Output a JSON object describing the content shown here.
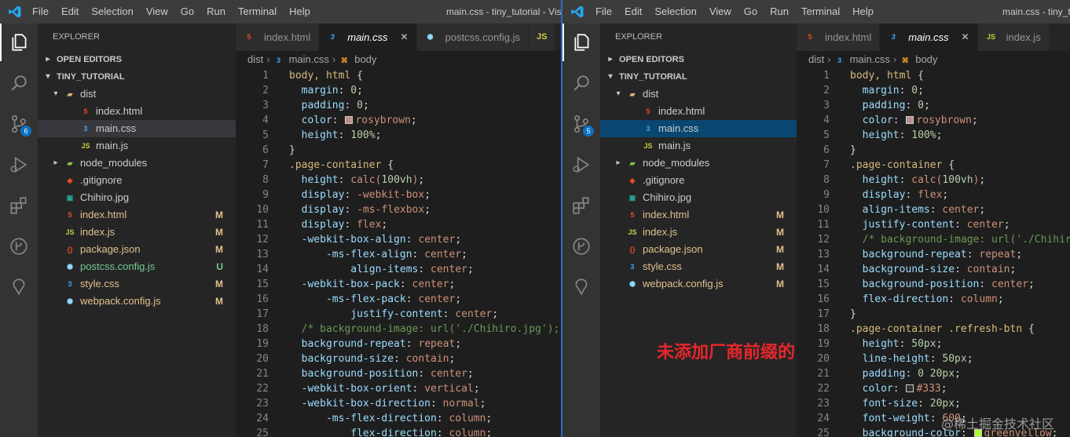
{
  "left": {
    "title": "main.css - tiny_tutorial - Visu",
    "menu": [
      "File",
      "Edit",
      "Selection",
      "View",
      "Go",
      "Run",
      "Terminal",
      "Help"
    ],
    "explorer_label": "EXPLORER",
    "open_editors": "OPEN EDITORS",
    "workspace": "TINY_TUTORIAL",
    "scm_badge": "6",
    "tree": [
      {
        "label": "dist",
        "icon": "folder",
        "depth": 1,
        "chev": "v"
      },
      {
        "label": "index.html",
        "icon": "html",
        "depth": 2
      },
      {
        "label": "main.css",
        "icon": "css",
        "depth": 2,
        "selected": true
      },
      {
        "label": "main.js",
        "icon": "js",
        "depth": 2
      },
      {
        "label": "node_modules",
        "icon": "nm",
        "depth": 1,
        "chev": ">"
      },
      {
        "label": ".gitignore",
        "icon": "git",
        "depth": 1
      },
      {
        "label": "Chihiro.jpg",
        "icon": "img",
        "depth": 1
      },
      {
        "label": "index.html",
        "icon": "html",
        "depth": 1,
        "status": "M"
      },
      {
        "label": "index.js",
        "icon": "js",
        "depth": 1,
        "status": "M"
      },
      {
        "label": "package.json",
        "icon": "json",
        "depth": 1,
        "status": "M"
      },
      {
        "label": "postcss.config.js",
        "icon": "wp",
        "depth": 1,
        "status": "U"
      },
      {
        "label": "style.css",
        "icon": "css",
        "depth": 1,
        "status": "M"
      },
      {
        "label": "webpack.config.js",
        "icon": "wp",
        "depth": 1,
        "status": "M"
      }
    ],
    "tabs": [
      {
        "label": "index.html",
        "icon": "html"
      },
      {
        "label": "main.css",
        "icon": "css",
        "active": true
      },
      {
        "label": "postcss.config.js",
        "icon": "wp"
      },
      {
        "label": "JS",
        "icon": "js"
      }
    ],
    "crumbs": [
      "dist",
      "main.css",
      "body"
    ],
    "code": [
      [
        [
          "sel",
          "body, html "
        ],
        [
          "pun",
          "{"
        ]
      ],
      [
        [
          "prop",
          "  margin"
        ],
        [
          "pun",
          ": "
        ],
        [
          "num",
          "0"
        ],
        [
          "pun",
          ";"
        ]
      ],
      [
        [
          "prop",
          "  padding"
        ],
        [
          "pun",
          ": "
        ],
        [
          "num",
          "0"
        ],
        [
          "pun",
          ";"
        ]
      ],
      [
        [
          "prop",
          "  color"
        ],
        [
          "pun",
          ": "
        ],
        [
          "swatch",
          "#bc8f8f"
        ],
        [
          "val",
          "rosybrown"
        ],
        [
          "pun",
          ";"
        ]
      ],
      [
        [
          "prop",
          "  height"
        ],
        [
          "pun",
          ": "
        ],
        [
          "num",
          "100%"
        ],
        [
          "pun",
          ";"
        ]
      ],
      [
        [
          "pun",
          "}"
        ]
      ],
      [
        [
          "sel",
          ".page-container "
        ],
        [
          "pun",
          "{"
        ]
      ],
      [
        [
          "prop",
          "  height"
        ],
        [
          "pun",
          ": "
        ],
        [
          "val",
          "calc("
        ],
        [
          "num",
          "100vh"
        ],
        [
          "val",
          ")"
        ],
        [
          "pun",
          ";"
        ]
      ],
      [
        [
          "prop",
          "  display"
        ],
        [
          "pun",
          ": "
        ],
        [
          "val",
          "-webkit-box"
        ],
        [
          "pun",
          ";"
        ]
      ],
      [
        [
          "prop",
          "  display"
        ],
        [
          "pun",
          ": "
        ],
        [
          "val",
          "-ms-flexbox"
        ],
        [
          "pun",
          ";"
        ]
      ],
      [
        [
          "prop",
          "  display"
        ],
        [
          "pun",
          ": "
        ],
        [
          "val",
          "flex"
        ],
        [
          "pun",
          ";"
        ]
      ],
      [
        [
          "prop",
          "  -webkit-box-align"
        ],
        [
          "pun",
          ": "
        ],
        [
          "val",
          "center"
        ],
        [
          "pun",
          ";"
        ]
      ],
      [
        [
          "prop",
          "      -ms-flex-align"
        ],
        [
          "pun",
          ": "
        ],
        [
          "val",
          "center"
        ],
        [
          "pun",
          ";"
        ]
      ],
      [
        [
          "prop",
          "          align-items"
        ],
        [
          "pun",
          ": "
        ],
        [
          "val",
          "center"
        ],
        [
          "pun",
          ";"
        ]
      ],
      [
        [
          "prop",
          "  -webkit-box-pack"
        ],
        [
          "pun",
          ": "
        ],
        [
          "val",
          "center"
        ],
        [
          "pun",
          ";"
        ]
      ],
      [
        [
          "prop",
          "      -ms-flex-pack"
        ],
        [
          "pun",
          ": "
        ],
        [
          "val",
          "center"
        ],
        [
          "pun",
          ";"
        ]
      ],
      [
        [
          "prop",
          "          justify-content"
        ],
        [
          "pun",
          ": "
        ],
        [
          "val",
          "center"
        ],
        [
          "pun",
          ";"
        ]
      ],
      [
        [
          "cmt",
          "  /* background-image: url('./Chihiro.jpg');"
        ]
      ],
      [
        [
          "prop",
          "  background-repeat"
        ],
        [
          "pun",
          ": "
        ],
        [
          "val",
          "repeat"
        ],
        [
          "pun",
          ";"
        ]
      ],
      [
        [
          "prop",
          "  background-size"
        ],
        [
          "pun",
          ": "
        ],
        [
          "val",
          "contain"
        ],
        [
          "pun",
          ";"
        ]
      ],
      [
        [
          "prop",
          "  background-position"
        ],
        [
          "pun",
          ": "
        ],
        [
          "val",
          "center"
        ],
        [
          "pun",
          ";"
        ]
      ],
      [
        [
          "prop",
          "  -webkit-box-orient"
        ],
        [
          "pun",
          ": "
        ],
        [
          "val",
          "vertical"
        ],
        [
          "pun",
          ";"
        ]
      ],
      [
        [
          "prop",
          "  -webkit-box-direction"
        ],
        [
          "pun",
          ": "
        ],
        [
          "val",
          "normal"
        ],
        [
          "pun",
          ";"
        ]
      ],
      [
        [
          "prop",
          "      -ms-flex-direction"
        ],
        [
          "pun",
          ": "
        ],
        [
          "val",
          "column"
        ],
        [
          "pun",
          ";"
        ]
      ],
      [
        [
          "prop",
          "          flex-direction"
        ],
        [
          "pun",
          ": "
        ],
        [
          "val",
          "column"
        ],
        [
          "pun",
          ";"
        ]
      ]
    ]
  },
  "right": {
    "title": "main.css - tiny_tu",
    "menu": [
      "File",
      "Edit",
      "Selection",
      "View",
      "Go",
      "Run",
      "Terminal",
      "Help"
    ],
    "explorer_label": "EXPLORER",
    "open_editors": "OPEN EDITORS",
    "workspace": "TINY_TUTORIAL",
    "scm_badge": "5",
    "tree": [
      {
        "label": "dist",
        "icon": "folder",
        "depth": 1,
        "chev": "v"
      },
      {
        "label": "index.html",
        "icon": "html",
        "depth": 2
      },
      {
        "label": "main.css",
        "icon": "css",
        "depth": 2,
        "selected": true
      },
      {
        "label": "main.js",
        "icon": "js",
        "depth": 2
      },
      {
        "label": "node_modules",
        "icon": "nm",
        "depth": 1,
        "chev": ">"
      },
      {
        "label": ".gitignore",
        "icon": "git",
        "depth": 1
      },
      {
        "label": "Chihiro.jpg",
        "icon": "img",
        "depth": 1
      },
      {
        "label": "index.html",
        "icon": "html",
        "depth": 1,
        "status": "M"
      },
      {
        "label": "index.js",
        "icon": "js",
        "depth": 1,
        "status": "M"
      },
      {
        "label": "package.json",
        "icon": "json",
        "depth": 1,
        "status": "M"
      },
      {
        "label": "style.css",
        "icon": "css",
        "depth": 1,
        "status": "M"
      },
      {
        "label": "webpack.config.js",
        "icon": "wp",
        "depth": 1,
        "status": "M"
      }
    ],
    "tabs": [
      {
        "label": "index.html",
        "icon": "html"
      },
      {
        "label": "main.css",
        "icon": "css",
        "active": true
      },
      {
        "label": "index.js",
        "icon": "js"
      }
    ],
    "crumbs": [
      "dist",
      "main.css",
      "body"
    ],
    "note": "未添加厂商前缀的",
    "watermark": "@稀土掘金技术社区",
    "code": [
      [
        [
          "sel",
          "body, html "
        ],
        [
          "pun",
          "{"
        ]
      ],
      [
        [
          "prop",
          "  margin"
        ],
        [
          "pun",
          ": "
        ],
        [
          "num",
          "0"
        ],
        [
          "pun",
          ";"
        ]
      ],
      [
        [
          "prop",
          "  padding"
        ],
        [
          "pun",
          ": "
        ],
        [
          "num",
          "0"
        ],
        [
          "pun",
          ";"
        ]
      ],
      [
        [
          "prop",
          "  color"
        ],
        [
          "pun",
          ": "
        ],
        [
          "swatch",
          "#bc8f8f"
        ],
        [
          "val",
          "rosybrown"
        ],
        [
          "pun",
          ";"
        ]
      ],
      [
        [
          "prop",
          "  height"
        ],
        [
          "pun",
          ": "
        ],
        [
          "num",
          "100%"
        ],
        [
          "pun",
          ";"
        ]
      ],
      [
        [
          "pun",
          "}"
        ]
      ],
      [
        [
          "sel",
          ".page-container "
        ],
        [
          "pun",
          "{"
        ]
      ],
      [
        [
          "prop",
          "  height"
        ],
        [
          "pun",
          ": "
        ],
        [
          "val",
          "calc("
        ],
        [
          "num",
          "100vh"
        ],
        [
          "val",
          ")"
        ],
        [
          "pun",
          ";"
        ]
      ],
      [
        [
          "prop",
          "  display"
        ],
        [
          "pun",
          ": "
        ],
        [
          "val",
          "flex"
        ],
        [
          "pun",
          ";"
        ]
      ],
      [
        [
          "prop",
          "  align-items"
        ],
        [
          "pun",
          ": "
        ],
        [
          "val",
          "center"
        ],
        [
          "pun",
          ";"
        ]
      ],
      [
        [
          "prop",
          "  justify-content"
        ],
        [
          "pun",
          ": "
        ],
        [
          "val",
          "center"
        ],
        [
          "pun",
          ";"
        ]
      ],
      [
        [
          "cmt",
          "  /* background-image: url('./Chihiro."
        ]
      ],
      [
        [
          "prop",
          "  background-repeat"
        ],
        [
          "pun",
          ": "
        ],
        [
          "val",
          "repeat"
        ],
        [
          "pun",
          ";"
        ]
      ],
      [
        [
          "prop",
          "  background-size"
        ],
        [
          "pun",
          ": "
        ],
        [
          "val",
          "contain"
        ],
        [
          "pun",
          ";"
        ]
      ],
      [
        [
          "prop",
          "  background-position"
        ],
        [
          "pun",
          ": "
        ],
        [
          "val",
          "center"
        ],
        [
          "pun",
          ";"
        ]
      ],
      [
        [
          "prop",
          "  flex-direction"
        ],
        [
          "pun",
          ": "
        ],
        [
          "val",
          "column"
        ],
        [
          "pun",
          ";"
        ]
      ],
      [
        [
          "pun",
          "}"
        ]
      ],
      [
        [
          "sel",
          ".page-container .refresh-btn "
        ],
        [
          "pun",
          "{"
        ]
      ],
      [
        [
          "prop",
          "  height"
        ],
        [
          "pun",
          ": "
        ],
        [
          "num",
          "50px"
        ],
        [
          "pun",
          ";"
        ]
      ],
      [
        [
          "prop",
          "  line-height"
        ],
        [
          "pun",
          ": "
        ],
        [
          "num",
          "50px"
        ],
        [
          "pun",
          ";"
        ]
      ],
      [
        [
          "prop",
          "  padding"
        ],
        [
          "pun",
          ": "
        ],
        [
          "num",
          "0 20px"
        ],
        [
          "pun",
          ";"
        ]
      ],
      [
        [
          "prop",
          "  color"
        ],
        [
          "pun",
          ": "
        ],
        [
          "swatch",
          "#333333"
        ],
        [
          "val",
          "#333"
        ],
        [
          "pun",
          ";"
        ]
      ],
      [
        [
          "prop",
          "  font-size"
        ],
        [
          "pun",
          ": "
        ],
        [
          "num",
          "20px"
        ],
        [
          "pun",
          ";"
        ]
      ],
      [
        [
          "prop",
          "  font-weight"
        ],
        [
          "pun",
          ": "
        ],
        [
          "val",
          "600"
        ],
        [
          "pun",
          ";"
        ]
      ],
      [
        [
          "prop",
          "  background-color"
        ],
        [
          "pun",
          ": "
        ],
        [
          "swatch",
          "#adff2f"
        ],
        [
          "val",
          "greenyellow"
        ],
        [
          "pun",
          ";"
        ]
      ]
    ]
  }
}
